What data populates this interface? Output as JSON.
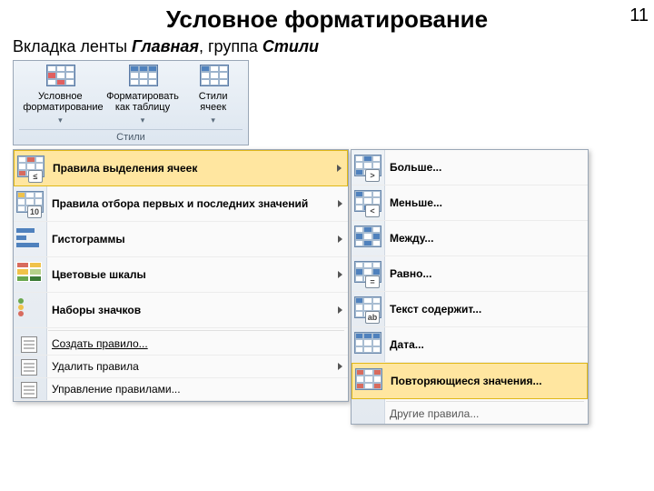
{
  "page_number": "11",
  "title": "Условное форматирование",
  "subline_prefix": "Вкладка ленты ",
  "subline_tab": "Главная",
  "subline_mid": ", группа ",
  "subline_group": "Стили",
  "ribbon": {
    "btn1": "Условное форматирование",
    "btn2": "Форматировать как таблицу",
    "btn3": "Стили ячеек",
    "group": "Стили"
  },
  "menu_left": {
    "i1": "Правила выделения ячеек",
    "i2": "Правила отбора первых и последних значений",
    "i3": "Гистограммы",
    "i4": "Цветовые шкалы",
    "i5": "Наборы значков",
    "i6": "Создать правило...",
    "i7": "Удалить правила",
    "i8": "Управление правилами..."
  },
  "menu_right": {
    "r1": "Больше...",
    "r2": "Меньше...",
    "r3": "Между...",
    "r4": "Равно...",
    "r5": "Текст содержит...",
    "r6": "Дата...",
    "r7": "Повторяющиеся значения...",
    "more": "Другие правила..."
  }
}
